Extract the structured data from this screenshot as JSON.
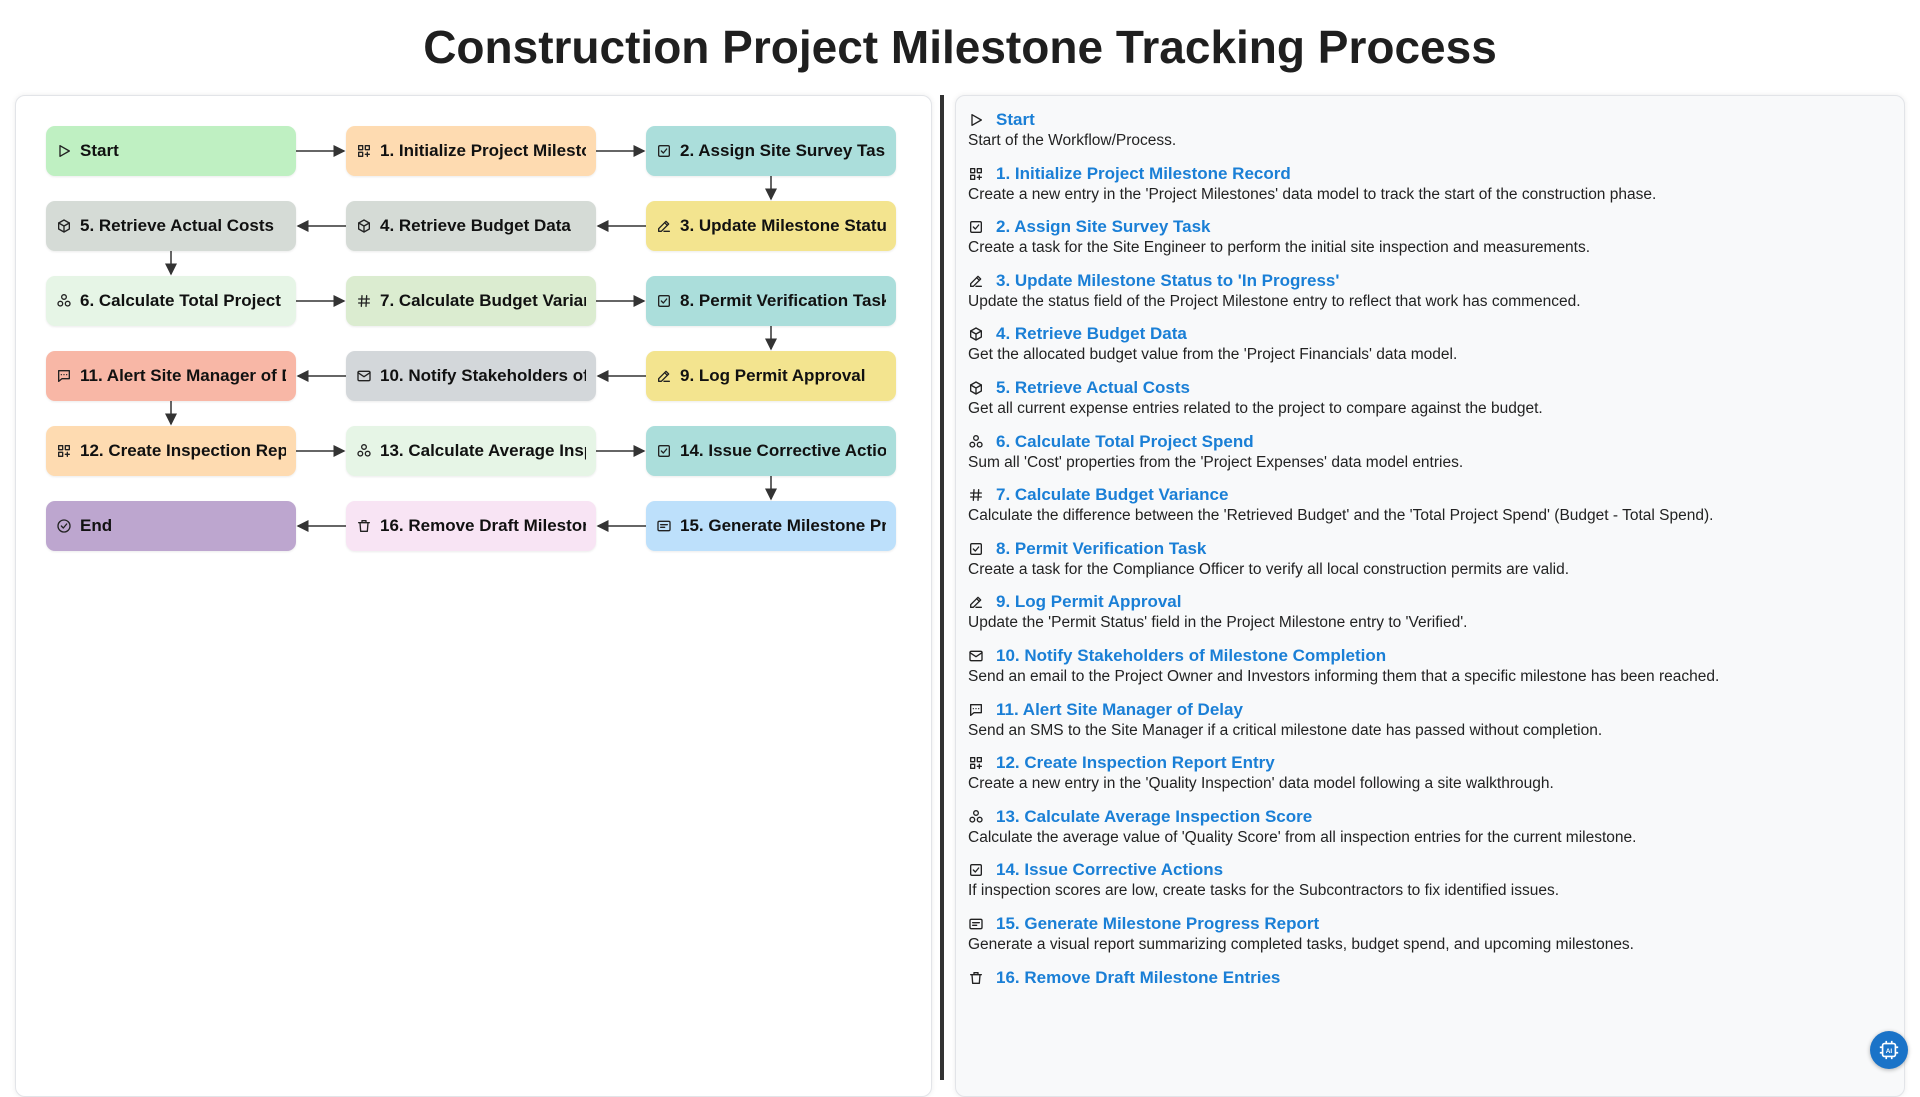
{
  "title": "Construction Project Milestone Tracking Process",
  "colors": {
    "green": "#bff0c2",
    "orange": "#fedbb1",
    "teal": "#abdedb",
    "yellow": "#f3e48f",
    "grey": "#d5dbd6",
    "lightgreen": "#e6f5e6",
    "olive": "#dbecd0",
    "salmon": "#f8b7a6",
    "slate": "#d3d7da",
    "pink": "#f8e4f4",
    "blue": "#bde0fb",
    "purple": "#bda6cf",
    "link": "#1a7fd6",
    "fab": "#1a73c8"
  },
  "nodes": [
    {
      "label": "Start",
      "icon": "play-icon",
      "color": "green"
    },
    {
      "label": "1. Initialize Project Milestone Record",
      "icon": "grid-plus-icon",
      "color": "orange"
    },
    {
      "label": "2. Assign Site Survey Task",
      "icon": "checkbox-icon",
      "color": "teal"
    },
    {
      "label": "3. Update Milestone Status to 'In Progress'",
      "icon": "edit-icon",
      "color": "yellow"
    },
    {
      "label": "4. Retrieve Budget Data",
      "icon": "cube-icon",
      "color": "grey"
    },
    {
      "label": "5. Retrieve Actual Costs",
      "icon": "cube-icon",
      "color": "grey"
    },
    {
      "label": "6. Calculate Total Project Spend",
      "icon": "cluster-icon",
      "color": "lightgreen"
    },
    {
      "label": "7. Calculate Budget Variance",
      "icon": "hash-icon",
      "color": "olive"
    },
    {
      "label": "8. Permit Verification Task",
      "icon": "checkbox-icon",
      "color": "teal"
    },
    {
      "label": "9. Log Permit Approval",
      "icon": "edit-icon",
      "color": "yellow"
    },
    {
      "label": "10. Notify Stakeholders of Milestone Completion",
      "icon": "mail-icon",
      "color": "slate"
    },
    {
      "label": "11. Alert Site Manager of Delay",
      "icon": "message-icon",
      "color": "salmon"
    },
    {
      "label": "12. Create Inspection Report Entry",
      "icon": "grid-plus-icon",
      "color": "orange"
    },
    {
      "label": "13. Calculate Average Inspection Score",
      "icon": "cluster-icon",
      "color": "lightgreen"
    },
    {
      "label": "14. Issue Corrective Actions",
      "icon": "checkbox-icon",
      "color": "teal"
    },
    {
      "label": "15. Generate Milestone Progress Report",
      "icon": "report-icon",
      "color": "blue"
    },
    {
      "label": "16. Remove Draft Milestone Entries",
      "icon": "trash-icon",
      "color": "pink"
    },
    {
      "label": "End",
      "icon": "check-circle-icon",
      "color": "purple"
    }
  ],
  "entries": [
    {
      "title": "Start",
      "icon": "play-icon",
      "desc": "Start of the Workflow/Process."
    },
    {
      "title": "1. Initialize Project Milestone Record",
      "icon": "grid-plus-icon",
      "desc": "Create a new entry in the 'Project Milestones' data model to track the start of the construction phase."
    },
    {
      "title": "2. Assign Site Survey Task",
      "icon": "checkbox-icon",
      "desc": "Create a task for the Site Engineer to perform the initial site inspection and measurements."
    },
    {
      "title": "3. Update Milestone Status to 'In Progress'",
      "icon": "edit-icon",
      "desc": "Update the status field of the Project Milestone entry to reflect that work has commenced."
    },
    {
      "title": "4. Retrieve Budget Data",
      "icon": "cube-icon",
      "desc": "Get the allocated budget value from the 'Project Financials' data model."
    },
    {
      "title": "5. Retrieve Actual Costs",
      "icon": "cube-icon",
      "desc": "Get all current expense entries related to the project to compare against the budget."
    },
    {
      "title": "6. Calculate Total Project Spend",
      "icon": "cluster-icon",
      "desc": "Sum all 'Cost' properties from the 'Project Expenses' data model entries."
    },
    {
      "title": "7. Calculate Budget Variance",
      "icon": "hash-icon",
      "desc": "Calculate the difference between the 'Retrieved Budget' and the 'Total Project Spend' (Budget - Total Spend)."
    },
    {
      "title": "8. Permit Verification Task",
      "icon": "checkbox-icon",
      "desc": "Create a task for the Compliance Officer to verify all local construction permits are valid."
    },
    {
      "title": "9. Log Permit Approval",
      "icon": "edit-icon",
      "desc": "Update the 'Permit Status' field in the Project Milestone entry to 'Verified'."
    },
    {
      "title": "10. Notify Stakeholders of Milestone Completion",
      "icon": "mail-icon",
      "desc": "Send an email to the Project Owner and Investors informing them that a specific milestone has been reached."
    },
    {
      "title": "11. Alert Site Manager of Delay",
      "icon": "message-icon",
      "desc": "Send an SMS to the Site Manager if a critical milestone date has passed without completion."
    },
    {
      "title": "12. Create Inspection Report Entry",
      "icon": "grid-plus-icon",
      "desc": "Create a new entry in the 'Quality Inspection' data model following a site walkthrough."
    },
    {
      "title": "13. Calculate Average Inspection Score",
      "icon": "cluster-icon",
      "desc": "Calculate the average value of 'Quality Score' from all inspection entries for the current milestone."
    },
    {
      "title": "14. Issue Corrective Actions",
      "icon": "checkbox-icon",
      "desc": "If inspection scores are low, create tasks for the Subcontractors to fix identified issues."
    },
    {
      "title": "15. Generate Milestone Progress Report",
      "icon": "report-icon",
      "desc": "Generate a visual report summarizing completed tasks, budget spend, and upcoming milestones."
    },
    {
      "title": "16. Remove Draft Milestone Entries",
      "icon": "trash-icon",
      "desc": ""
    }
  ],
  "fab": {
    "icon": "ai-chip-icon"
  }
}
